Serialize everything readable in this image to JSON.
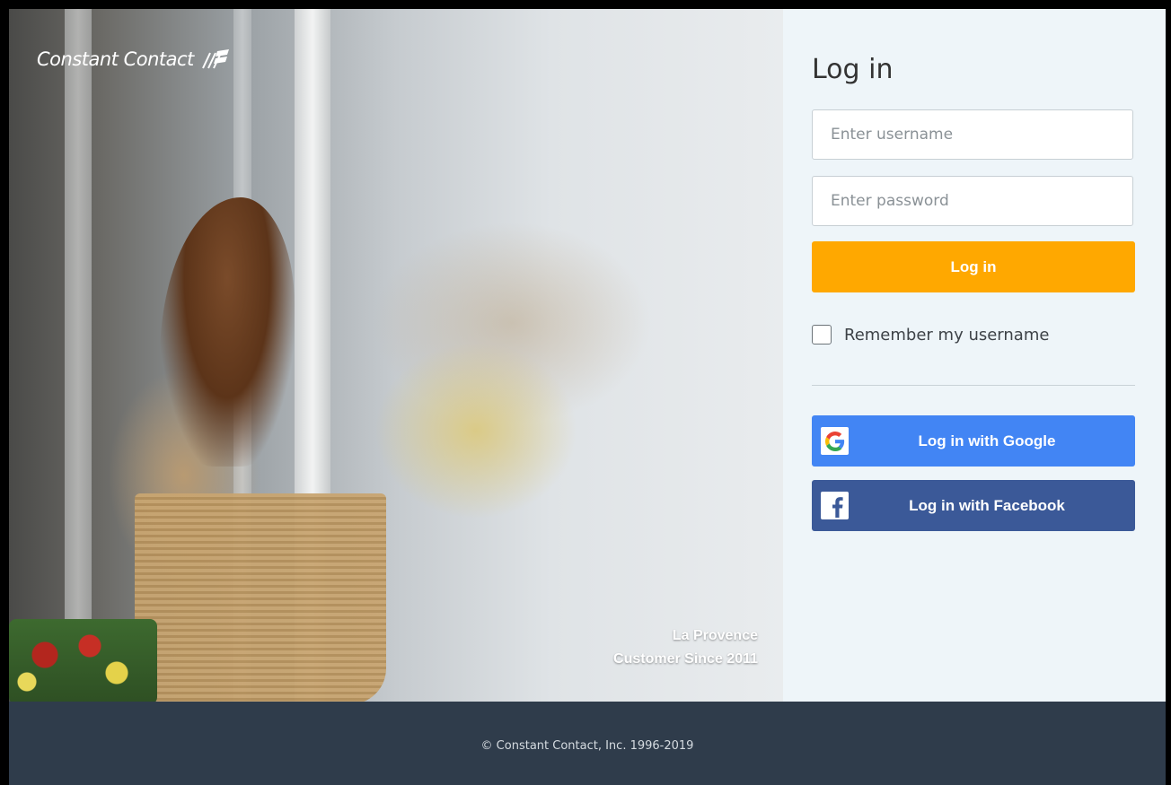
{
  "brand": {
    "logo_text": "Constant Contact",
    "logo_icon": "flag-stripes-icon"
  },
  "hero": {
    "caption_line1": "La Provence",
    "caption_line2": "Customer Since 2011"
  },
  "login": {
    "title": "Log in",
    "username_placeholder": "Enter username",
    "username_value": "",
    "password_placeholder": "Enter password",
    "password_value": "",
    "submit_label": "Log in",
    "remember_label": "Remember my username",
    "remember_checked": false,
    "google_label": "Log in with Google",
    "google_icon": "google-icon",
    "facebook_label": "Log in with Facebook",
    "facebook_icon": "facebook-icon"
  },
  "footer": {
    "copyright": "© Constant Contact, Inc. 1996-2019"
  },
  "colors": {
    "accent_orange": "#ffa800",
    "google_blue": "#4285f4",
    "facebook_blue": "#3b5998",
    "footer_bg": "#2f3c4b",
    "panel_bg": "#eef5f9"
  }
}
